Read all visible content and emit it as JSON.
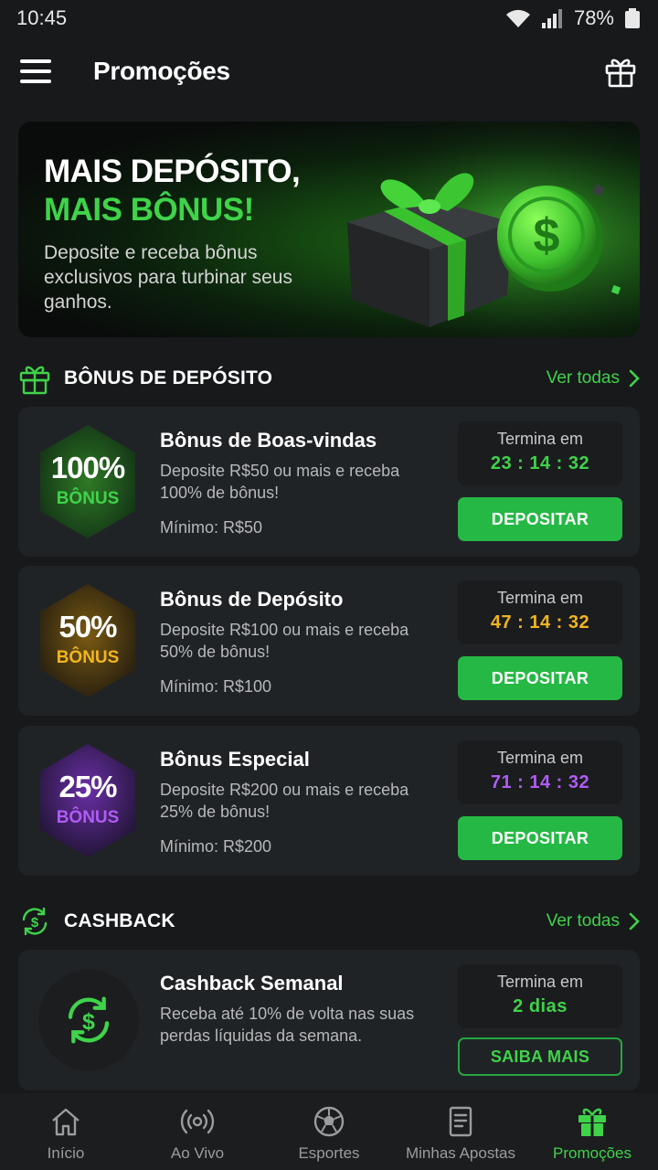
{
  "status_bar": {
    "time": "10:45",
    "battery": "78%"
  },
  "header": {
    "title": "Promoções"
  },
  "hero": {
    "title_line1": "MAIS DEPÓSITO,",
    "title_line2": "MAIS BÔNUS!",
    "subtitle": "Deposite e receba bônus exclusivos para turbinar seus ganhos."
  },
  "deposit_section": {
    "title": "BÔNUS DE DEPÓSITO",
    "see_all": "Ver todas",
    "cards": [
      {
        "badge_pct": "100%",
        "badge_label": "BÔNUS",
        "title": "Bônus de Boas-vindas",
        "description": "Deposite R$50 ou mais e receba 100% de bônus!",
        "minimum": "Mínimo: R$50",
        "timer_label": "Termina em",
        "timer_value": "23 : 14 : 32",
        "button": "DEPOSITAR",
        "accent": "#3fd34a"
      },
      {
        "badge_pct": "50%",
        "badge_label": "BÔNUS",
        "title": "Bônus de Depósito",
        "description": "Deposite R$100 ou mais e receba 50% de bônus!",
        "minimum": "Mínimo: R$100",
        "timer_label": "Termina em",
        "timer_value": "47 : 14 : 32",
        "button": "DEPOSITAR",
        "accent": "#f2b51d"
      },
      {
        "badge_pct": "25%",
        "badge_label": "BÔNUS",
        "title": "Bônus Especial",
        "description": "Deposite R$200 ou mais e receba 25% de bônus!",
        "minimum": "Mínimo: R$200",
        "timer_label": "Termina em",
        "timer_value": "71 : 14 : 32",
        "button": "DEPOSITAR",
        "accent": "#b05cf5"
      }
    ]
  },
  "cashback_section": {
    "title": "CASHBACK",
    "see_all": "Ver todas",
    "card": {
      "title": "Cashback Semanal",
      "description": "Receba até 10% de volta nas suas perdas líquidas da semana.",
      "timer_label": "Termina em",
      "timer_value": "2 dias",
      "button": "SAIBA MAIS"
    }
  },
  "bottom_nav": {
    "items": [
      {
        "label": "Início",
        "icon": "home-icon"
      },
      {
        "label": "Ao Vivo",
        "icon": "live-icon"
      },
      {
        "label": "Esportes",
        "icon": "soccer-ball-icon"
      },
      {
        "label": "Minhas Apostas",
        "icon": "bet-slip-icon"
      },
      {
        "label": "Promoções",
        "icon": "gift-icon",
        "active": true
      }
    ]
  },
  "colors": {
    "brand_green": "#3fd34a",
    "button_green": "#25b845",
    "background": "#17191b",
    "card": "#202326"
  }
}
